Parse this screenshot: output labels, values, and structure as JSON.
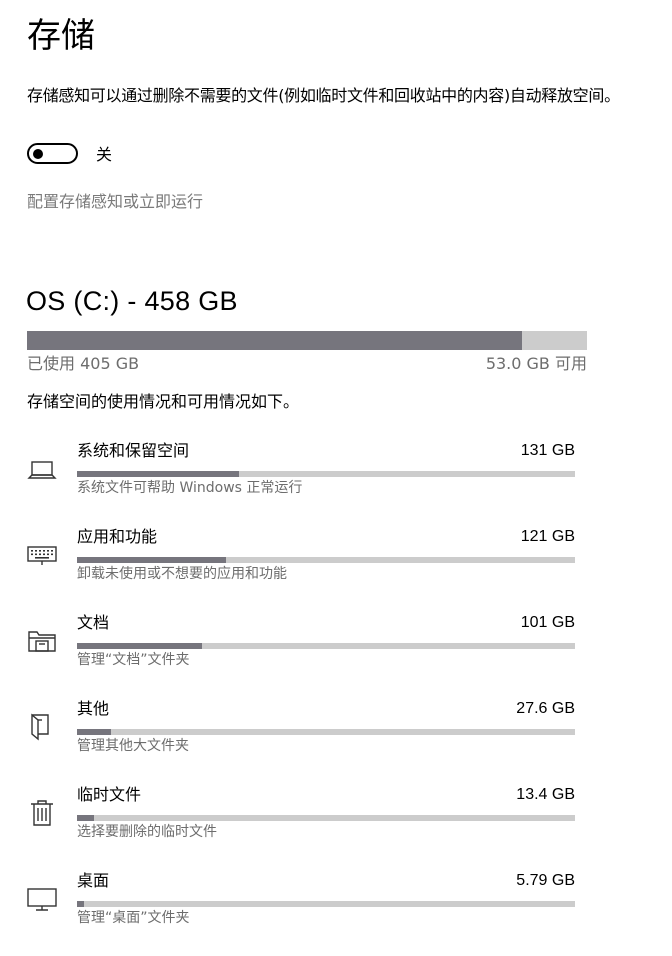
{
  "page": {
    "title": "存储"
  },
  "storage_sense": {
    "description": "存储感知可以通过删除不需要的文件(例如临时文件和回收站中的内容)自动释放空间。",
    "toggle_on": false,
    "toggle_label": "关",
    "config_link": "配置存储感知或立即运行"
  },
  "drive": {
    "title": "OS (C:) - 458 GB",
    "used_fraction": 0.884,
    "used_label": "已使用 405 GB",
    "free_label": "53.0 GB 可用"
  },
  "usage": {
    "description": "存储空间的使用情况和可用情况如下。",
    "categories": [
      {
        "icon": "laptop-icon",
        "name": "系统和保留空间",
        "size": "131 GB",
        "fraction": 0.325,
        "description": "系统文件可帮助 Windows 正常运行"
      },
      {
        "icon": "keyboard-icon",
        "name": "应用和功能",
        "size": "121 GB",
        "fraction": 0.3,
        "description": "卸载未使用或不想要的应用和功能"
      },
      {
        "icon": "documents-folder-icon",
        "name": "文档",
        "size": "101 GB",
        "fraction": 0.25,
        "description": "管理“文档”文件夹"
      },
      {
        "icon": "other-folder-icon",
        "name": "其他",
        "size": "27.6 GB",
        "fraction": 0.068,
        "description": "管理其他大文件夹"
      },
      {
        "icon": "trash-icon",
        "name": "临时文件",
        "size": "13.4 GB",
        "fraction": 0.034,
        "description": "选择要删除的临时文件"
      },
      {
        "icon": "monitor-icon",
        "name": "桌面",
        "size": "5.79 GB",
        "fraction": 0.014,
        "description": "管理“桌面”文件夹"
      }
    ]
  }
}
